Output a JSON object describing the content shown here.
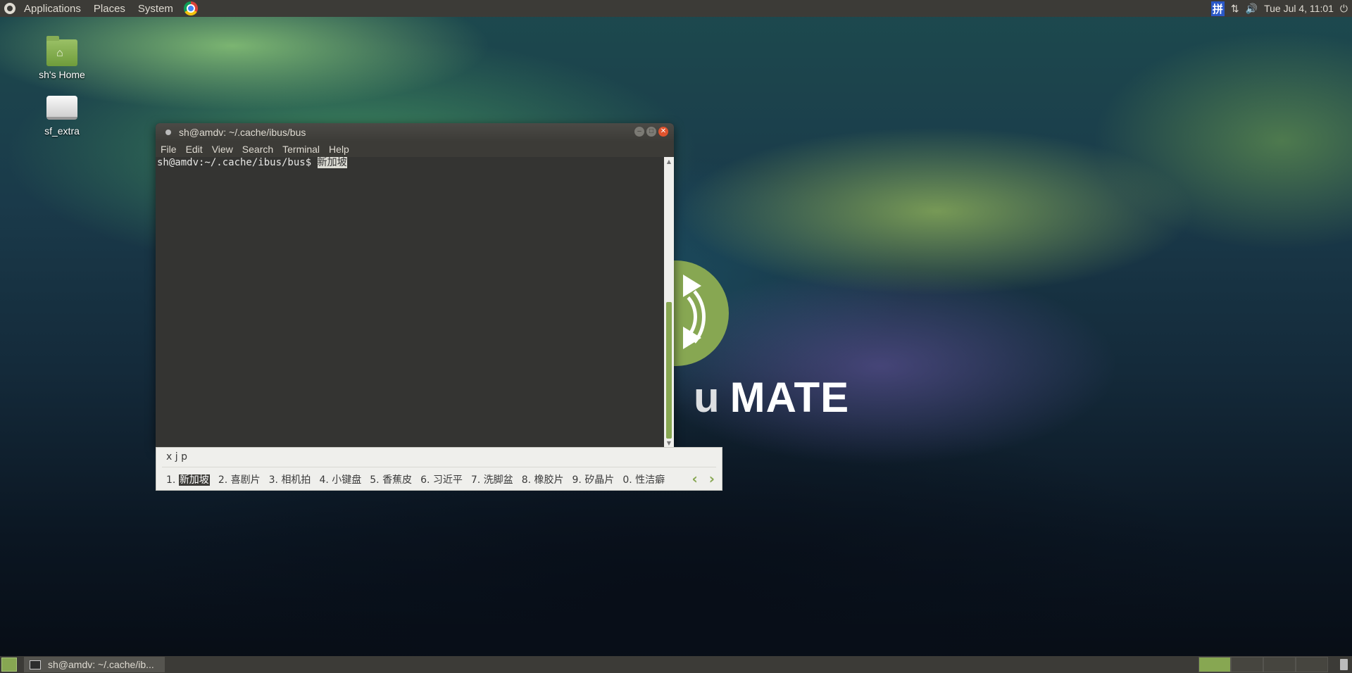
{
  "top_panel": {
    "applications": "Applications",
    "places": "Places",
    "system": "System",
    "ime_indicator": "拼",
    "clock": "Tue Jul  4, 11:01"
  },
  "desktop_icons": {
    "home": "sh's Home",
    "drive": "sf_extra"
  },
  "wallpaper": {
    "logo_text": "MATE",
    "logo_prefix": "u"
  },
  "terminal": {
    "title": "sh@amdv: ~/.cache/ibus/bus",
    "menu": [
      "File",
      "Edit",
      "View",
      "Search",
      "Terminal",
      "Help"
    ],
    "prompt": "sh@amdv:~/.cache/ibus/bus$ ",
    "preedit": "新加坡"
  },
  "ibus": {
    "input": "x j p",
    "candidates": [
      {
        "num": "1.",
        "text": "新加坡"
      },
      {
        "num": "2.",
        "text": "喜剧片"
      },
      {
        "num": "3.",
        "text": "相机拍"
      },
      {
        "num": "4.",
        "text": "小键盘"
      },
      {
        "num": "5.",
        "text": "香蕉皮"
      },
      {
        "num": "6.",
        "text": "习近平"
      },
      {
        "num": "7.",
        "text": "洗脚盆"
      },
      {
        "num": "8.",
        "text": "橡胶片"
      },
      {
        "num": "9.",
        "text": "矽晶片"
      },
      {
        "num": "0.",
        "text": "性洁癖"
      }
    ]
  },
  "bottom_panel": {
    "task_terminal": "sh@amdv: ~/.cache/ib..."
  },
  "colors": {
    "accent": "#87a752",
    "panel": "#3c3b37",
    "terminal_bg": "#343432"
  }
}
